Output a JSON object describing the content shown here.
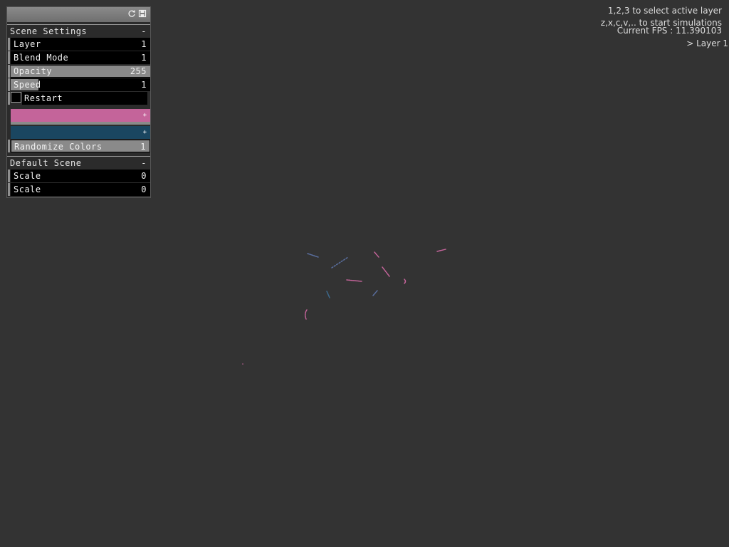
{
  "hud": {
    "instructions_1": "1,2,3 to select active layer",
    "instructions_2": "z,x,c,v,.. to start simulations",
    "fps": "Current FPS : 11.390103",
    "active_layer": "> Layer 1"
  },
  "panel": {
    "header_icons": [
      "refresh-icon",
      "save-icon"
    ],
    "scene_settings": {
      "title": "Scene Settings",
      "toggle": "-",
      "layer": {
        "label": "Layer",
        "value": "1"
      },
      "blend_mode": {
        "label": "Blend Mode",
        "value": "1"
      },
      "opacity": {
        "label": "Opacity",
        "value": "255",
        "fill": 1.0
      },
      "speed": {
        "label": "Speed",
        "value": "1",
        "fill": 0.2
      },
      "restart": {
        "label": "Restart",
        "checked": false
      },
      "color1": {
        "hex": "#c4649a",
        "plus": "+"
      },
      "color2": {
        "hex": "#1a4660",
        "plus": "+"
      },
      "randomize": {
        "label": "Randomize Colors",
        "value": "1"
      }
    },
    "default_scene": {
      "title": "Default Scene",
      "toggle": "-",
      "scale1": {
        "label": "Scale",
        "value": "0"
      },
      "scale2": {
        "label": "Scale",
        "value": "0"
      }
    }
  },
  "colors": {
    "background": "#333333",
    "pink": "#c4649a",
    "blue": "#3d5c8a"
  }
}
